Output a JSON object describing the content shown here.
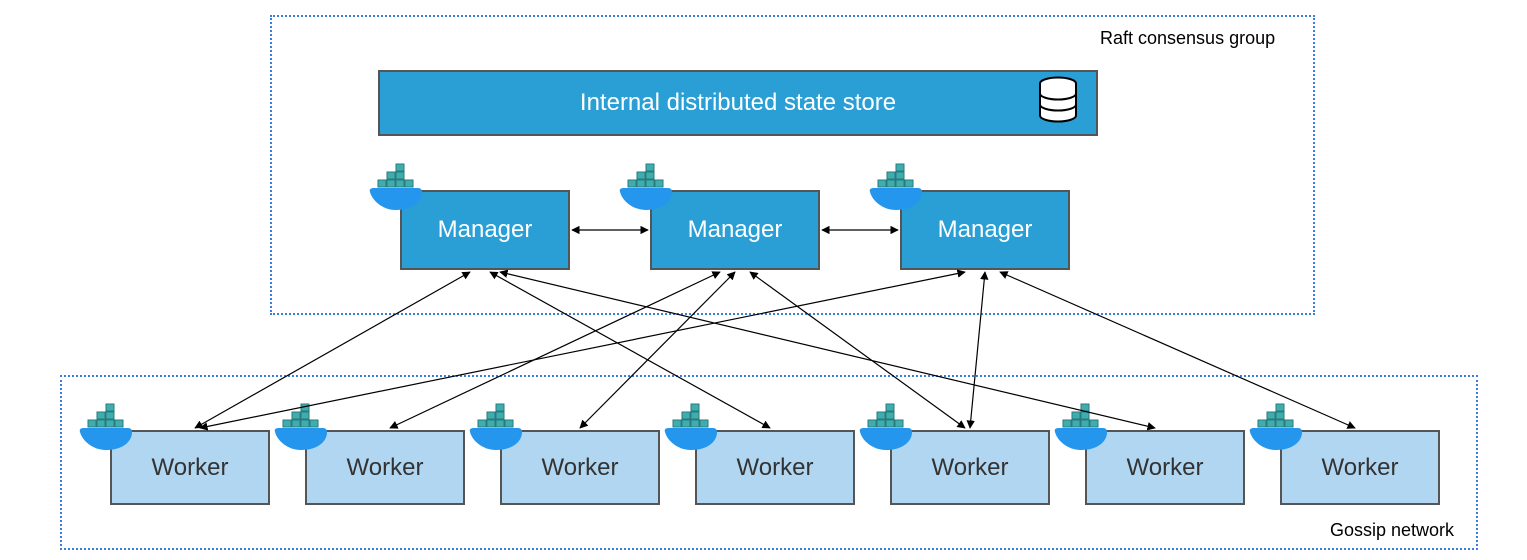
{
  "raft_group": {
    "label": "Raft consensus group"
  },
  "gossip_net": {
    "label": "Gossip network"
  },
  "state_store": {
    "label": "Internal distributed state store"
  },
  "managers": [
    {
      "label": "Manager"
    },
    {
      "label": "Manager"
    },
    {
      "label": "Manager"
    }
  ],
  "workers": [
    {
      "label": "Worker"
    },
    {
      "label": "Worker"
    },
    {
      "label": "Worker"
    },
    {
      "label": "Worker"
    },
    {
      "label": "Worker"
    },
    {
      "label": "Worker"
    },
    {
      "label": "Worker"
    }
  ],
  "connections": {
    "manager_to_manager": [
      {
        "from": 0,
        "to": 1
      },
      {
        "from": 1,
        "to": 2
      }
    ],
    "manager_to_worker": [
      {
        "manager": 0,
        "worker": 0
      },
      {
        "manager": 0,
        "worker": 3
      },
      {
        "manager": 0,
        "worker": 5
      },
      {
        "manager": 1,
        "worker": 1
      },
      {
        "manager": 1,
        "worker": 2
      },
      {
        "manager": 1,
        "worker": 4
      },
      {
        "manager": 2,
        "worker": 0
      },
      {
        "manager": 2,
        "worker": 4
      },
      {
        "manager": 2,
        "worker": 6
      }
    ]
  },
  "colors": {
    "manager_bg": "#2a9fd6",
    "worker_bg": "#b0d6f1",
    "docker_whale": "#2496ed",
    "docker_containers": "#3eadb0",
    "border_dotted": "#3b7dd8"
  }
}
